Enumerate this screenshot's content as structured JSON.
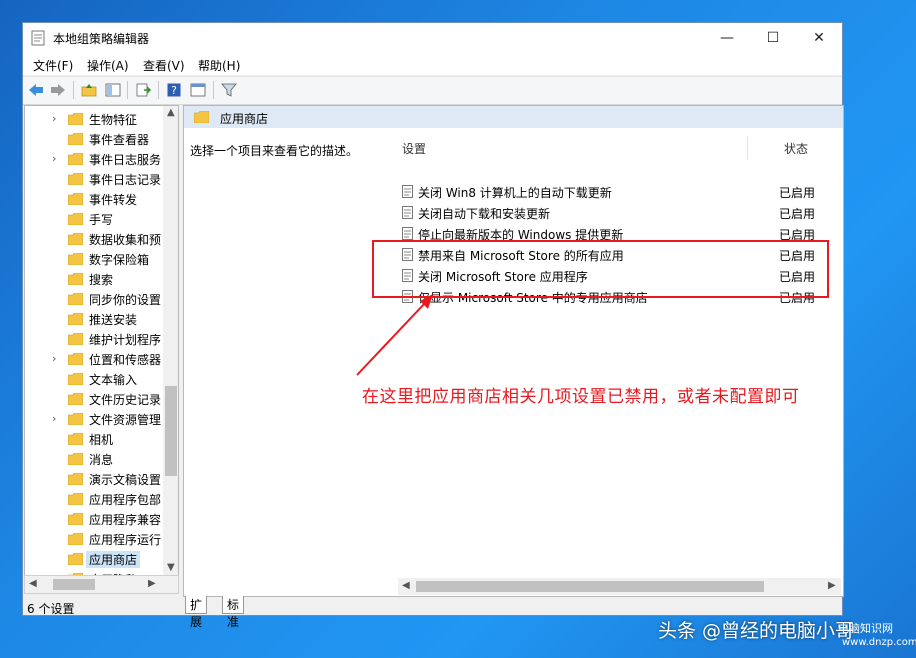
{
  "window": {
    "title": "本地组策略编辑器",
    "minimize_glyph": "—",
    "maximize_glyph": "☐",
    "close_glyph": "✕"
  },
  "menu": [
    {
      "label": "文件(F)"
    },
    {
      "label": "操作(A)"
    },
    {
      "label": "查看(V)"
    },
    {
      "label": "帮助(H)"
    }
  ],
  "tree": {
    "items": [
      {
        "label": "生物特征",
        "expandable": true
      },
      {
        "label": "事件查看器",
        "expandable": false
      },
      {
        "label": "事件日志服务",
        "expandable": true
      },
      {
        "label": "事件日志记录",
        "expandable": false
      },
      {
        "label": "事件转发",
        "expandable": false
      },
      {
        "label": "手写",
        "expandable": false
      },
      {
        "label": "数据收集和预",
        "expandable": false
      },
      {
        "label": "数字保险箱",
        "expandable": false
      },
      {
        "label": "搜索",
        "expandable": false
      },
      {
        "label": "同步你的设置",
        "expandable": false
      },
      {
        "label": "推送安装",
        "expandable": false
      },
      {
        "label": "维护计划程序",
        "expandable": false
      },
      {
        "label": "位置和传感器",
        "expandable": true
      },
      {
        "label": "文本输入",
        "expandable": false
      },
      {
        "label": "文件历史记录",
        "expandable": false
      },
      {
        "label": "文件资源管理",
        "expandable": true
      },
      {
        "label": "相机",
        "expandable": false
      },
      {
        "label": "消息",
        "expandable": false
      },
      {
        "label": "演示文稿设置",
        "expandable": false
      },
      {
        "label": "应用程序包部",
        "expandable": false
      },
      {
        "label": "应用程序兼容",
        "expandable": false
      },
      {
        "label": "应用程序运行",
        "expandable": false
      },
      {
        "label": "应用商店",
        "expandable": false,
        "selected": true
      },
      {
        "label": "应用隐私",
        "expandable": false
      }
    ]
  },
  "pane": {
    "header": "应用商店",
    "description": "选择一个项目来查看它的描述。",
    "col_setting": "设置",
    "col_state": "状态"
  },
  "settings": [
    {
      "name": "关闭 Win8 计算机上的自动下载更新",
      "state": "已启用"
    },
    {
      "name": "关闭自动下载和安装更新",
      "state": "已启用"
    },
    {
      "name": "停止向最新版本的 Windows 提供更新",
      "state": "已启用"
    },
    {
      "name": "禁用来自 Microsoft Store 的所有应用",
      "state": "已启用"
    },
    {
      "name": "关闭 Microsoft Store 应用程序",
      "state": "已启用"
    },
    {
      "name": "仅显示 Microsoft Store 中的专用应用商店",
      "state": "已启用"
    }
  ],
  "tabs": [
    {
      "label": "扩展"
    },
    {
      "label": "标准"
    }
  ],
  "status": "6 个设置",
  "annotation": "在这里把应用商店相关几项设置已禁用，或者未配置即可",
  "watermark": {
    "main": "头条 @曾经的电脑小哥",
    "site_name": "电脑知识网",
    "site_url": "www.dnzp.com"
  },
  "colors": {
    "highlight_red": "#e8191f",
    "pane_header_bg": "#dfe9f5",
    "folder_yellow": "#f4c542",
    "selection_bg": "#cce4f7"
  }
}
